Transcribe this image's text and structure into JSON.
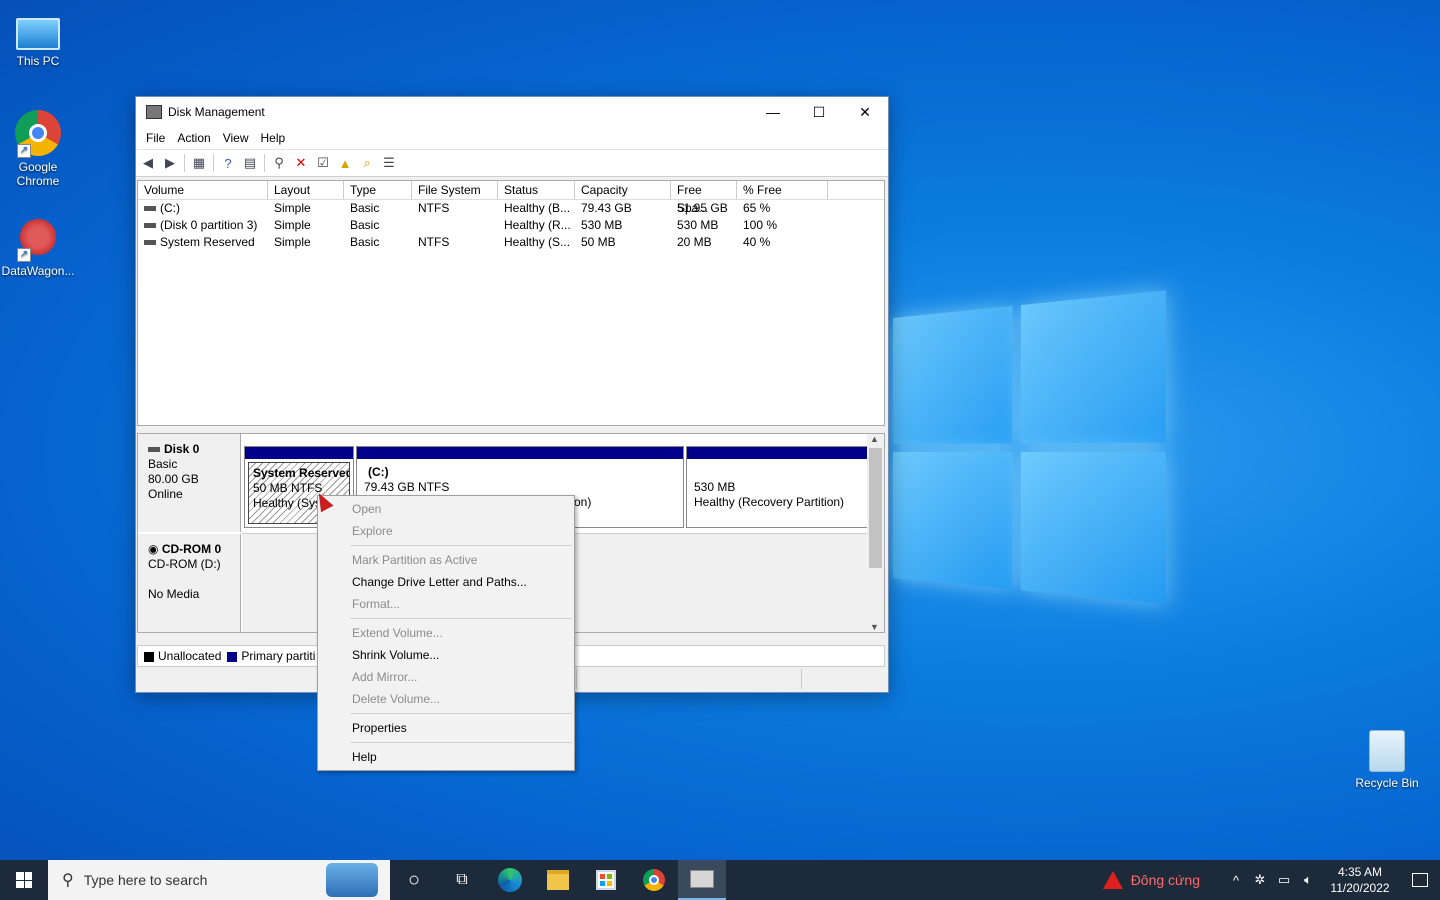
{
  "desktop": {
    "icons": [
      {
        "label": "This PC"
      },
      {
        "label": "Google\nChrome"
      },
      {
        "label": "DataWagon..."
      },
      {
        "label": "Recycle Bin"
      }
    ]
  },
  "window": {
    "title": "Disk Management",
    "menu": [
      "File",
      "Action",
      "View",
      "Help"
    ],
    "volume_table": {
      "columns": [
        "Volume",
        "Layout",
        "Type",
        "File System",
        "Status",
        "Capacity",
        "Free Spa...",
        "% Free"
      ],
      "rows": [
        [
          "(C:)",
          "Simple",
          "Basic",
          "NTFS",
          "Healthy (B...",
          "79.43 GB",
          "51.95 GB",
          "65 %"
        ],
        [
          "(Disk 0 partition 3)",
          "Simple",
          "Basic",
          "",
          "Healthy (R...",
          "530 MB",
          "530 MB",
          "100 %"
        ],
        [
          "System Reserved",
          "Simple",
          "Basic",
          "NTFS",
          "Healthy (S...",
          "50 MB",
          "20 MB",
          "40 %"
        ]
      ]
    },
    "disks": {
      "disk0": {
        "name": "Disk 0",
        "type": "Basic",
        "size": "80.00 GB",
        "state": "Online",
        "partitions": [
          {
            "name": "System Reserved",
            "line1": "50 MB NTFS",
            "line2": "Healthy (Syst"
          },
          {
            "name": "(C:)",
            "line1": "79.43 GB NTFS",
            "line2": "on)"
          },
          {
            "name": "",
            "line1": "530 MB",
            "line2": "Healthy (Recovery Partition)"
          }
        ]
      },
      "cdrom0": {
        "name": "CD-ROM 0",
        "type": "CD-ROM (D:)",
        "state": "No Media"
      }
    },
    "legend": {
      "unallocated": "Unallocated",
      "primary": "Primary partiti"
    }
  },
  "context_menu": {
    "items": [
      {
        "label": "Open",
        "enabled": false
      },
      {
        "label": "Explore",
        "enabled": false
      },
      {
        "label": "Mark Partition as Active",
        "enabled": false
      },
      {
        "label": "Change Drive Letter and Paths...",
        "enabled": true
      },
      {
        "label": "Format...",
        "enabled": false
      },
      {
        "label": "Extend Volume...",
        "enabled": false
      },
      {
        "label": "Shrink Volume...",
        "enabled": true
      },
      {
        "label": "Add Mirror...",
        "enabled": false
      },
      {
        "label": "Delete Volume...",
        "enabled": false
      },
      {
        "label": "Properties",
        "enabled": true
      },
      {
        "label": "Help",
        "enabled": true
      }
    ]
  },
  "taskbar": {
    "search_placeholder": "Type here to search",
    "weather": "Đông cứng",
    "time": "4:35 AM",
    "date": "11/20/2022"
  },
  "colors": {
    "primary_partition": "#00008b",
    "unallocated": "#000000",
    "desktop_accent": "#0b7de0"
  }
}
